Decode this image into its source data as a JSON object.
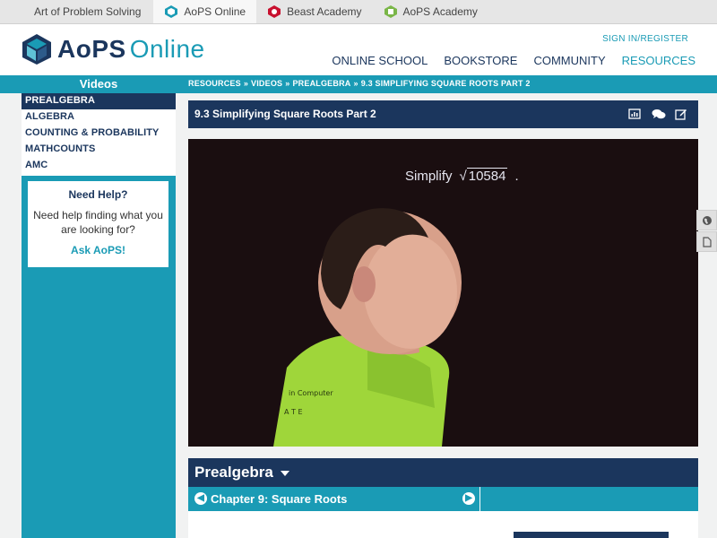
{
  "topbar": {
    "sites": [
      {
        "label": "Art of Problem Solving"
      },
      {
        "label": "AoPS Online"
      },
      {
        "label": "Beast Academy"
      },
      {
        "label": "AoPS Academy"
      }
    ]
  },
  "header": {
    "brand_main": "AoPS",
    "brand_sub": "Online",
    "signin": "SIGN IN/REGISTER",
    "nav": [
      "ONLINE SCHOOL",
      "BOOKSTORE",
      "COMMUNITY",
      "RESOURCES"
    ]
  },
  "sidebar": {
    "title": "Videos",
    "categories": [
      "PREALGEBRA",
      "ALGEBRA",
      "COUNTING & PROBABILITY",
      "MATHCOUNTS",
      "AMC"
    ],
    "help": {
      "heading": "Need Help?",
      "text": "Need help finding what you are looking for?",
      "link": "Ask AoPS!"
    }
  },
  "breadcrumb": [
    "RESOURCES",
    "VIDEOS",
    "PREALGEBRA",
    "9.3 SIMPLIFYING SQUARE ROOTS PART 2"
  ],
  "video": {
    "title": "9.3 Simplifying Square Roots Part 2",
    "caption_word": "Simplify",
    "caption_radicand": "10584",
    "caption_end": "."
  },
  "course": {
    "title": "Prealgebra",
    "chapter": "Chapter 9: Square Roots"
  },
  "colors": {
    "navy": "#1b365d",
    "teal": "#1a9bb5"
  }
}
